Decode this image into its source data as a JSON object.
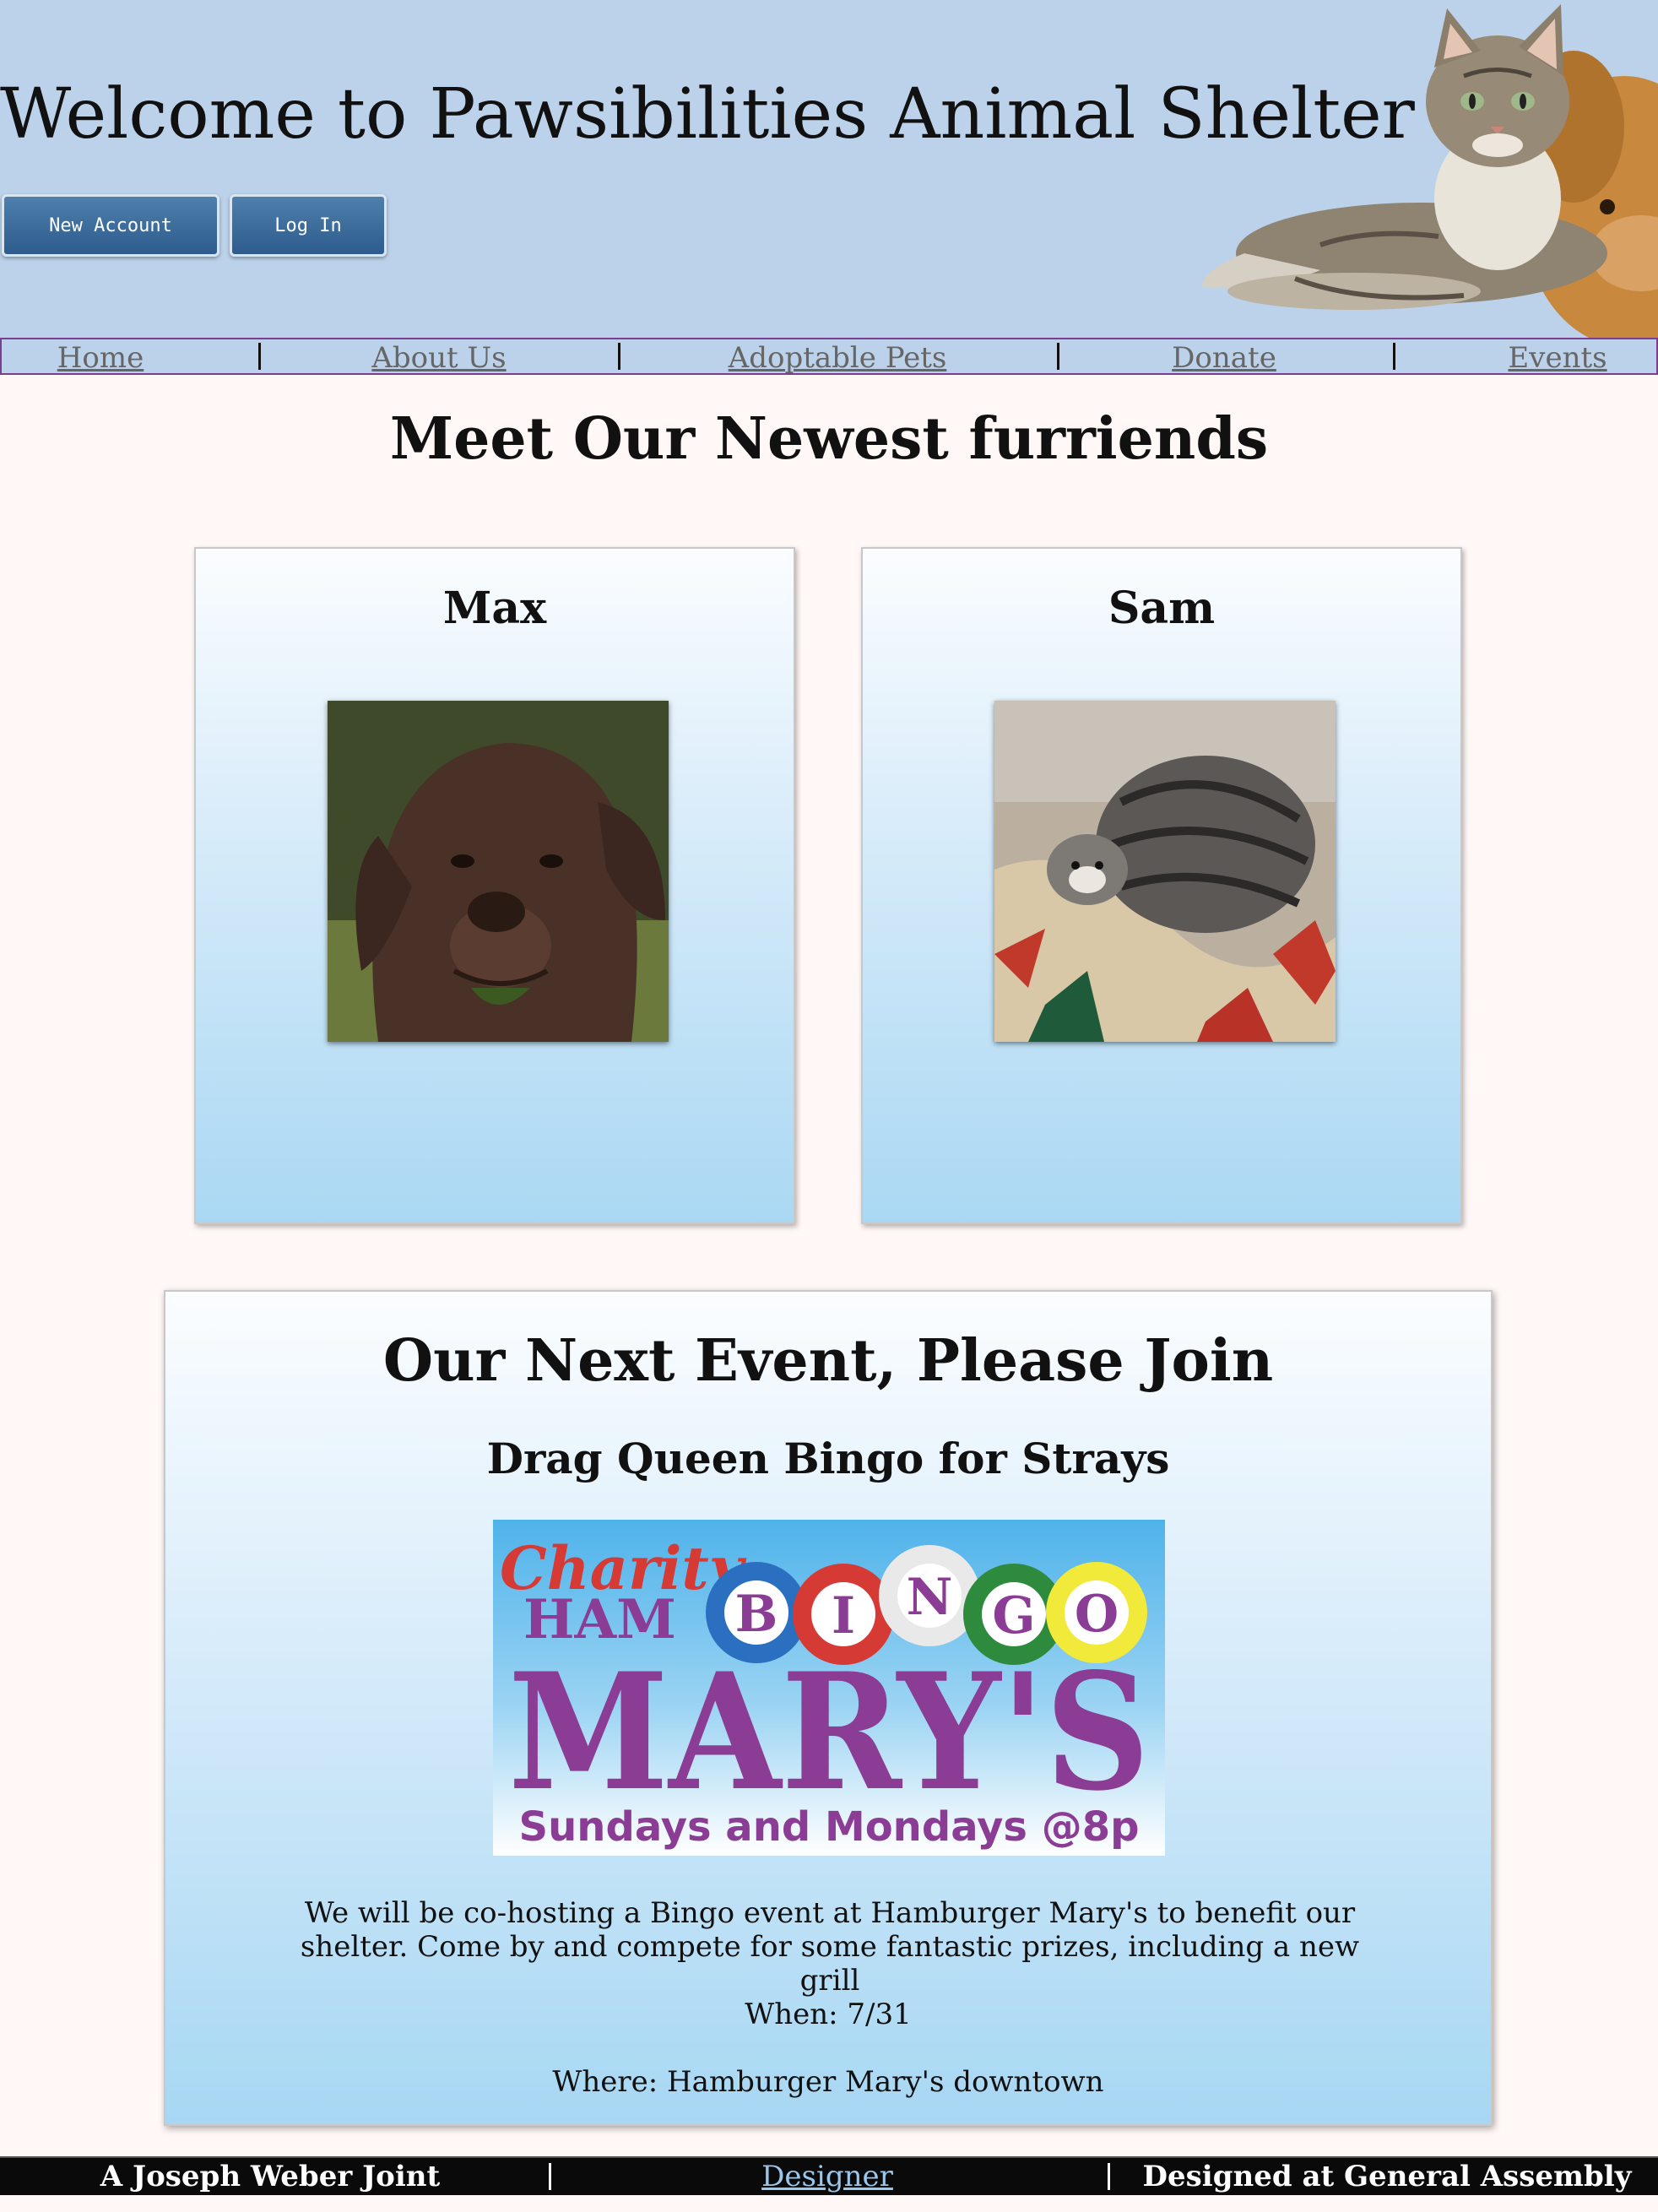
{
  "header": {
    "title": "Welcome to Pawsibilities Animal Shelter",
    "new_account_label": "New Account",
    "login_label": "Log In"
  },
  "nav": {
    "items": [
      "Home",
      "About Us",
      "Adoptable Pets",
      "Donate",
      "Events"
    ]
  },
  "newest": {
    "title": "Meet Our Newest furriends",
    "pets": [
      {
        "name": "Max"
      },
      {
        "name": "Sam"
      }
    ]
  },
  "event": {
    "title": "Our Next Event, Please Join",
    "name": "Drag Queen Bingo for Strays",
    "logo": {
      "script_text": "Charity",
      "ham_text": "HAM",
      "bingo_letters": [
        "B",
        "I",
        "N",
        "G",
        "O"
      ],
      "marys_text": "MARY'S",
      "schedule_text": "Sundays and Mondays @8p"
    },
    "description": "We will be co-hosting a Bingo event at Hamburger Mary's to benefit our shelter. Come by and compete for some fantastic prizes, including a new grill",
    "when": "When: 7/31",
    "where": "Where: Hamburger Mary's downtown"
  },
  "footer": {
    "credit": "A Joseph Weber Joint",
    "designer_link": "Designer",
    "assembly": "Designed at General Assembly"
  },
  "colors": {
    "header_bg": "#bcd2ea",
    "button_blue": "#2d5c8d",
    "nav_border": "#7b3d8f",
    "card_gradient_bottom": "#aad8f3",
    "footer_bg": "#0a0a0a",
    "logo_purple": "#8b3c94"
  }
}
